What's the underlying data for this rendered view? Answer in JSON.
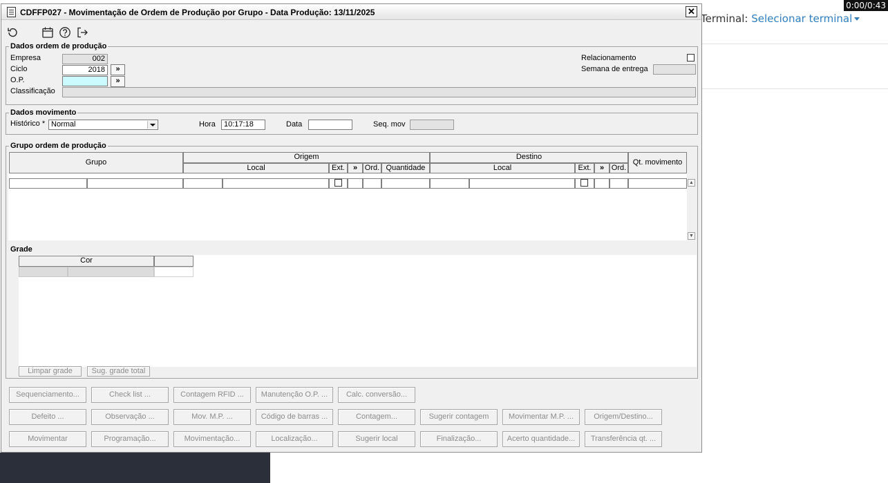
{
  "background_page": {
    "terminal_label": "Terminal:",
    "terminal_link": "Selecionar terminal",
    "timer": "0:00/0:43"
  },
  "window": {
    "title": "CDFFP027 - Movimentação de Ordem de Produção por Grupo - Data Produção: 13/11/2025",
    "close_label": "✕"
  },
  "toolbar": {
    "icons": [
      "refresh-icon",
      "calendar-icon",
      "help-icon",
      "exit-icon"
    ]
  },
  "dados_ordem": {
    "title": "Dados ordem de produção",
    "empresa_label": "Empresa",
    "empresa_value": "002",
    "ciclo_label": "Ciclo",
    "ciclo_value": "2018",
    "op_label": "O.P.",
    "op_value": "",
    "classificacao_label": "Classificação",
    "classificacao_value": "",
    "relacionamento_label": "Relacionamento",
    "semana_label": "Semana de entrega",
    "semana_value": "",
    "lookup_label": "»"
  },
  "dados_movimento": {
    "title": "Dados movimento",
    "historico_label": "Histórico *",
    "historico_value": "Normal",
    "hora_label": "Hora",
    "hora_value": "10:17:18",
    "data_label": "Data",
    "data_value": "",
    "seq_label": "Seq. mov",
    "seq_value": ""
  },
  "grupo_ordem": {
    "title": "Grupo ordem de produção",
    "headers": {
      "grupo": "Grupo",
      "origem": "Origem",
      "destino": "Destino",
      "local_origem": "Local",
      "ext_origem": "Ext.",
      "arrow_origem": "»",
      "ord_origem": "Ord.",
      "quantidade": "Quantidade",
      "local_destino": "Local",
      "ext_destino": "Ext.",
      "arrow_destino": "»",
      "ord_destino": "Ord.",
      "qt_movimento": "Qt. movimento"
    }
  },
  "grade": {
    "title": "Grade",
    "cor_header": "Cor",
    "limpar_label": "Limpar grade",
    "sugerir_label": "Sug. grade total"
  },
  "buttons": {
    "row1": [
      "Sequenciamento...",
      "Check list ...",
      "Contagem RFID ...",
      "Manutenção O.P. ...",
      "Calc. conversão..."
    ],
    "row2": [
      "Defeito ...",
      "Observação ...",
      "Mov. M.P. ...",
      "Código de barras ...",
      "Contagem...",
      "Sugerir contagem",
      "Movimentar M.P. ...",
      "Origem/Destino..."
    ],
    "row3": [
      "Movimentar",
      "Programação...",
      "Movimentação...",
      "Localização...",
      "Sugerir local",
      "Finalização...",
      "Acerto quantidade...",
      "Transferência qt. ..."
    ]
  }
}
